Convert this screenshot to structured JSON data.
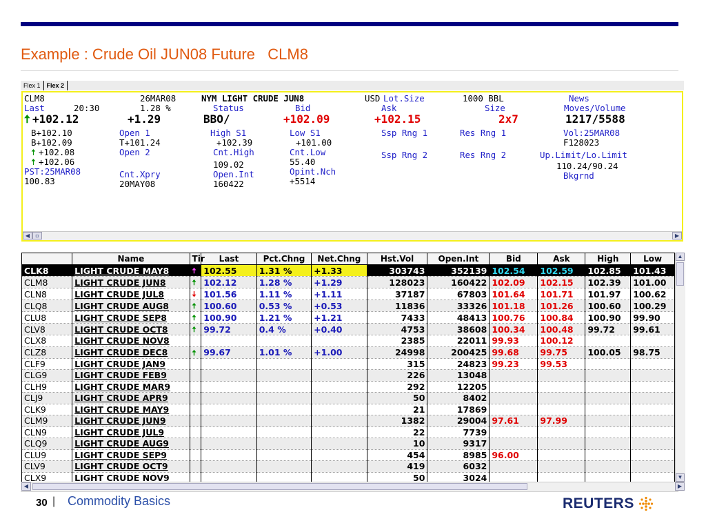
{
  "slide": {
    "title": "Example : Crude Oil JUN08 Future   CLM8",
    "page_number": "30",
    "separator": "|",
    "footer_text": "Commodity Basics",
    "logo_text": "REUTERS",
    "accent_color": "#000080",
    "title_color": "#e05a10"
  },
  "tabs": [
    "Flex 1",
    "Flex 2"
  ],
  "quote": {
    "ric": "CLM8",
    "date": "26MAR08",
    "description": "NYM LIGHT CRUDE JUN8",
    "currency": "USD",
    "lot_size_label": "Lot.Size",
    "lot_size_value": "1000 BBL",
    "news_label": "News",
    "last_label": "Last",
    "last_time": "20:30",
    "last_pct": "1.28 %",
    "status_label": "Status",
    "bid_label": "Bid",
    "ask_label": "Ask",
    "size_label": "Size",
    "moves_label": "Moves/Volume",
    "last_value": "+102.12",
    "net_change": "+1.29",
    "status_value": "BBO/",
    "bid_value": "+102.09",
    "ask_value": "+102.15",
    "size_value": "2x7",
    "moves_value": "1217/5588",
    "hist1": "B+102.10",
    "open1_label": "Open 1",
    "high_s1_label": "High S1",
    "low_s1_label": "Low S1",
    "ssp_rng1_label": "Ssp Rng 1",
    "res_rng1_label": "Res Rng 1",
    "vol_date": "Vol:25MAR08",
    "hist2": "B+102.09",
    "open1_value": "T+101.24",
    "high_s1_value": "+102.39",
    "low_s1_value": "+101.00",
    "vol_value": "F128023",
    "hist3": "+102.08",
    "open2_label": "Open 2",
    "cnt_high_label": "Cnt.High",
    "cnt_low_label": "Cnt.Low",
    "ssp_rng2_label": "Ssp Rng 2",
    "res_rng2_label": "Res Rng 2",
    "limit_label": "Up.Limit/Lo.Limit",
    "hist4": "+102.06",
    "cnt_high_value": "109.02",
    "cnt_low_value": "55.40",
    "limit_value": "110.24/90.24",
    "pst_label": "PST:25MAR08",
    "cnt_xpry_label": "Cnt.Xpry",
    "open_int_label": "Open.Int",
    "opint_nch_label": "Opint.Nch",
    "bkgrnd_label": "Bkgrnd",
    "pst_value": "100.83",
    "cnt_xpry_value": "20MAY08",
    "open_int_value": "160422",
    "opint_nch_value": "+5514"
  },
  "grid": {
    "columns": [
      "",
      "Name",
      "Tir",
      "Last",
      "Pct.Chng",
      "Net.Chng",
      "Hst.Vol",
      "Open.Int",
      "Bid",
      "Ask",
      "High",
      "Low"
    ],
    "rows": [
      {
        "ric": "CLK8",
        "name": "LIGHT CRUDE MAY8",
        "tick": "up",
        "last": "102.55",
        "pct": "1.31 %",
        "net": "+1.33",
        "vol": "303743",
        "oi": "352139",
        "bid": "102.54",
        "ask": "102.59",
        "high": "102.85",
        "low": "101.43"
      },
      {
        "ric": "CLM8",
        "name": "LIGHT CRUDE JUN8",
        "tick": "up",
        "last": "102.12",
        "pct": "1.28 %",
        "net": "+1.29",
        "vol": "128023",
        "oi": "160422",
        "bid": "102.09",
        "ask": "102.15",
        "high": "102.39",
        "low": "101.00"
      },
      {
        "ric": "CLN8",
        "name": "LIGHT CRUDE JUL8",
        "tick": "down",
        "last": "101.56",
        "pct": "1.11 %",
        "net": "+1.11",
        "vol": "37187",
        "oi": "67803",
        "bid": "101.64",
        "ask": "101.71",
        "high": "101.97",
        "low": "100.62"
      },
      {
        "ric": "CLQ8",
        "name": "LIGHT CRUDE AUG8",
        "tick": "up",
        "last": "100.60",
        "pct": "0.53 %",
        "net": "+0.53",
        "vol": "11836",
        "oi": "33326",
        "bid": "101.18",
        "ask": "101.26",
        "high": "100.60",
        "low": "100.29"
      },
      {
        "ric": "CLU8",
        "name": "LIGHT CRUDE SEP8",
        "tick": "up",
        "last": "100.90",
        "pct": "1.21 %",
        "net": "+1.21",
        "vol": "7433",
        "oi": "48413",
        "bid": "100.76",
        "ask": "100.84",
        "high": "100.90",
        "low": "99.90"
      },
      {
        "ric": "CLV8",
        "name": "LIGHT CRUDE OCT8",
        "tick": "up",
        "last": "99.72",
        "pct": "0.4 %",
        "net": "+0.40",
        "vol": "4753",
        "oi": "38608",
        "bid": "100.34",
        "ask": "100.48",
        "high": "99.72",
        "low": "99.61"
      },
      {
        "ric": "CLX8",
        "name": "LIGHT CRUDE NOV8",
        "tick": "",
        "last": "",
        "pct": "",
        "net": "",
        "vol": "2385",
        "oi": "22011",
        "bid": "99.93",
        "ask": "100.12",
        "high": "",
        "low": ""
      },
      {
        "ric": "CLZ8",
        "name": "LIGHT CRUDE DEC8",
        "tick": "up",
        "last": "99.67",
        "pct": "1.01 %",
        "net": "+1.00",
        "vol": "24998",
        "oi": "200425",
        "bid": "99.68",
        "ask": "99.75",
        "high": "100.05",
        "low": "98.75"
      },
      {
        "ric": "CLF9",
        "name": "LIGHT CRUDE JAN9",
        "tick": "",
        "last": "",
        "pct": "",
        "net": "",
        "vol": "315",
        "oi": "24823",
        "bid": "99.23",
        "ask": "99.53",
        "high": "",
        "low": ""
      },
      {
        "ric": "CLG9",
        "name": "LIGHT CRUDE FEB9",
        "tick": "",
        "last": "",
        "pct": "",
        "net": "",
        "vol": "226",
        "oi": "13048",
        "bid": "",
        "ask": "",
        "high": "",
        "low": ""
      },
      {
        "ric": "CLH9",
        "name": "LIGHT CRUDE MAR9",
        "tick": "",
        "last": "",
        "pct": "",
        "net": "",
        "vol": "292",
        "oi": "12205",
        "bid": "",
        "ask": "",
        "high": "",
        "low": ""
      },
      {
        "ric": "CLJ9",
        "name": "LIGHT CRUDE APR9",
        "tick": "",
        "last": "",
        "pct": "",
        "net": "",
        "vol": "50",
        "oi": "8402",
        "bid": "",
        "ask": "",
        "high": "",
        "low": ""
      },
      {
        "ric": "CLK9",
        "name": "LIGHT CRUDE MAY9",
        "tick": "",
        "last": "",
        "pct": "",
        "net": "",
        "vol": "21",
        "oi": "17869",
        "bid": "",
        "ask": "",
        "high": "",
        "low": ""
      },
      {
        "ric": "CLM9",
        "name": "LIGHT CRUDE JUN9",
        "tick": "",
        "last": "",
        "pct": "",
        "net": "",
        "vol": "1382",
        "oi": "29004",
        "bid": "97.61",
        "ask": "97.99",
        "high": "",
        "low": ""
      },
      {
        "ric": "CLN9",
        "name": "LIGHT CRUDE JUL9",
        "tick": "",
        "last": "",
        "pct": "",
        "net": "",
        "vol": "22",
        "oi": "7739",
        "bid": "",
        "ask": "",
        "high": "",
        "low": ""
      },
      {
        "ric": "CLQ9",
        "name": "LIGHT CRUDE AUG9",
        "tick": "",
        "last": "",
        "pct": "",
        "net": "",
        "vol": "10",
        "oi": "9317",
        "bid": "",
        "ask": "",
        "high": "",
        "low": ""
      },
      {
        "ric": "CLU9",
        "name": "LIGHT CRUDE SEP9",
        "tick": "",
        "last": "",
        "pct": "",
        "net": "",
        "vol": "454",
        "oi": "8985",
        "bid": "96.00",
        "ask": "",
        "high": "",
        "low": ""
      },
      {
        "ric": "CLV9",
        "name": "LIGHT CRUDE OCT9",
        "tick": "",
        "last": "",
        "pct": "",
        "net": "",
        "vol": "419",
        "oi": "6032",
        "bid": "",
        "ask": "",
        "high": "",
        "low": ""
      },
      {
        "ric": "CLX9",
        "name": "LIGHT CRUDE NOV9",
        "tick": "",
        "last": "",
        "pct": "",
        "net": "",
        "vol": "50",
        "oi": "3024",
        "bid": "",
        "ask": "",
        "high": "",
        "low": ""
      }
    ]
  },
  "icons": {
    "up_arrow": "arrow-up-icon",
    "down_arrow": "arrow-down-icon",
    "logo_mark": "reuters-dots-icon"
  },
  "colors": {
    "panel_border": "#f4f01c",
    "up": "#009000",
    "down": "#e00000",
    "bid_ask": "#e00000",
    "positive_blue": "#1a1ab8"
  }
}
